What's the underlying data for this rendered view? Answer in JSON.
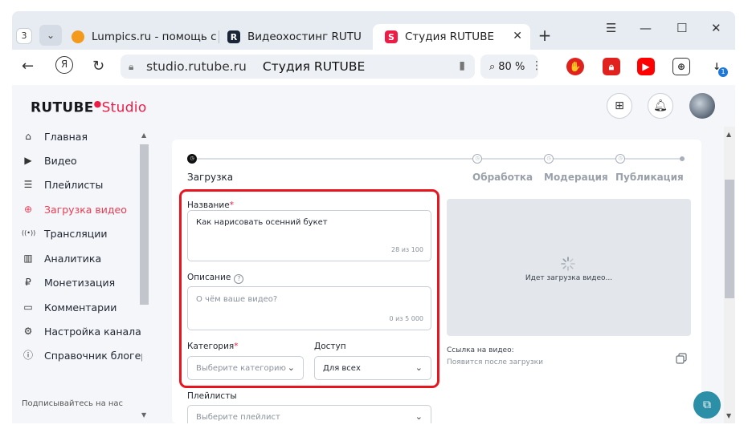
{
  "browser": {
    "tab_count": "3",
    "tabs": [
      {
        "label": "Lumpics.ru - помощь с к",
        "favicon": "orange-icon",
        "color": "#f39a1c"
      },
      {
        "label": "Видеохостинг RUTUBE.",
        "favicon": "rutube-icon",
        "color": "#1b2538"
      },
      {
        "label": "Студия RUTUBE",
        "favicon": "rutube-studio-icon",
        "color": "#ec1c46"
      }
    ],
    "url_host": "studio.rutube.ru",
    "url_title": "Студия RUTUBE",
    "zoom": "80 %",
    "download_badge": "1"
  },
  "header": {
    "logo_main": "RUTUBE",
    "logo_studio": "Studio"
  },
  "sidebar": {
    "items": [
      {
        "label": "Главная",
        "icon": "home-icon",
        "glyph": "⌂"
      },
      {
        "label": "Видео",
        "icon": "video-icon",
        "glyph": "▶"
      },
      {
        "label": "Плейлисты",
        "icon": "playlist-icon",
        "glyph": "☰"
      },
      {
        "label": "Загрузка видео",
        "icon": "upload-icon",
        "glyph": "⊕"
      },
      {
        "label": "Трансляции",
        "icon": "broadcast-icon",
        "glyph": "((•))"
      },
      {
        "label": "Аналитика",
        "icon": "analytics-icon",
        "glyph": "▥"
      },
      {
        "label": "Монетизация",
        "icon": "ruble-icon",
        "glyph": "₽"
      },
      {
        "label": "Комментарии",
        "icon": "comment-icon",
        "glyph": "▭"
      },
      {
        "label": "Настройка канала",
        "icon": "gear-icon",
        "glyph": "⚙"
      },
      {
        "label": "Справочник блогера",
        "icon": "info-icon",
        "glyph": "ⓘ"
      }
    ],
    "active_index": 3,
    "subscribe_label": "Подписывайтесь на нас"
  },
  "steps": {
    "items": [
      "Загрузка",
      "Обработка",
      "Модерация",
      "Публикация"
    ],
    "active_index": 0
  },
  "form": {
    "title_label": "Название",
    "title_value": "Как нарисовать осенний букет",
    "title_counter": "28 из 100",
    "description_label": "Описание",
    "description_placeholder": "О чём ваше видео?",
    "description_counter": "0 из 5 000",
    "category_label": "Категория",
    "category_placeholder": "Выберите категорию",
    "access_label": "Доступ",
    "access_value": "Для всех",
    "playlists_label": "Плейлисты",
    "playlists_placeholder": "Выберите плейлист",
    "required_mark": "*"
  },
  "preview": {
    "loading_text": "Идет загрузка видео...",
    "link_label": "Ссылка на видео:",
    "link_value": "Появится после загрузки"
  },
  "colors": {
    "accent": "#ec1c46",
    "highlight": "#e8141e",
    "fab": "#2b8fa7"
  }
}
